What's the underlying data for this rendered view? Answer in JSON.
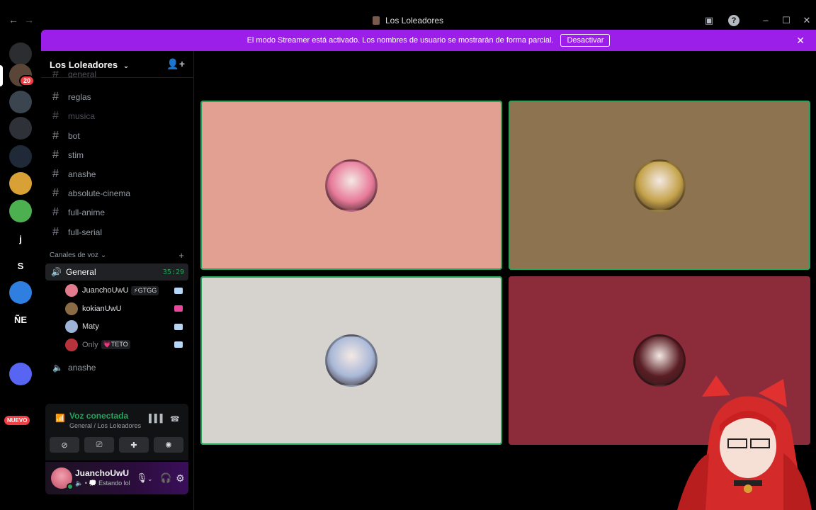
{
  "window": {
    "title": "Los Loleadores"
  },
  "rail": {
    "mentions_badge": "20",
    "servers": [
      {
        "label": "",
        "color": "#2b2d31"
      },
      {
        "label": "",
        "color": "#5a4636"
      },
      {
        "label": "",
        "color": "#3b4550"
      },
      {
        "label": "",
        "color": "#2e3138"
      },
      {
        "label": "",
        "color": "#1f2937"
      },
      {
        "label": "",
        "color": "#d9a036"
      },
      {
        "label": "",
        "color": "#4caf50"
      },
      {
        "label": "j",
        "color": "#000000"
      },
      {
        "label": "S",
        "color": "#000000"
      },
      {
        "label": "",
        "color": "#2f7fe0"
      },
      {
        "label": "ÑE",
        "color": "#000000"
      },
      {
        "label": "",
        "color": "#000000"
      },
      {
        "label": "",
        "color": "#5865f2"
      }
    ],
    "new_badge": "NUEVO"
  },
  "banner": {
    "message": "El modo Streamer está activado. Los nombres de usuario se mostrarán de forma parcial.",
    "button": "Desactivar",
    "color": "#9b1fe8"
  },
  "guild": {
    "name": "Los Loleadores",
    "text_channels": [
      {
        "name": "general",
        "muted": true
      },
      {
        "name": "reglas",
        "muted": false
      },
      {
        "name": "musica",
        "muted": true
      },
      {
        "name": "bot",
        "muted": false
      },
      {
        "name": "stim",
        "muted": false
      },
      {
        "name": "anashe",
        "muted": false
      },
      {
        "name": "absolute-cinema",
        "muted": false
      },
      {
        "name": "full-anime",
        "muted": false
      },
      {
        "name": "full-serial",
        "muted": false
      }
    ],
    "voice_category": "Canales de voz",
    "voice_channel": {
      "name": "General",
      "timer": "35:29",
      "users": [
        {
          "name": "JuanchoUwU",
          "tag": "⚡GTGG",
          "avatar_color": "#e27b8c"
        },
        {
          "name": "kokianUwU",
          "tag": "",
          "avatar_color": "#8b6b45"
        },
        {
          "name": "Maty",
          "tag": "",
          "avatar_color": "#9db4d8"
        },
        {
          "name": "Only",
          "tag": "💗TETO",
          "avatar_color": "#b8323c"
        }
      ]
    },
    "voice_channel_2": "anashe"
  },
  "voice_panel": {
    "title": "Voz conectada",
    "subtitle": "General / Los Loleadores"
  },
  "user_panel": {
    "name": "JuanchoUwU",
    "status": "Estando lol"
  },
  "grid": {
    "tiles": [
      {
        "bg": "#e2a093",
        "avatar": "#e87a9a",
        "speaking": true
      },
      {
        "bg": "#8e7351",
        "avatar": "#c4a24a",
        "speaking": true
      },
      {
        "bg": "#d6d2ce",
        "avatar": "#a9b8d8",
        "speaking": true
      },
      {
        "bg": "#8c2c3b",
        "avatar": "#5a1d24",
        "speaking": false
      }
    ]
  }
}
